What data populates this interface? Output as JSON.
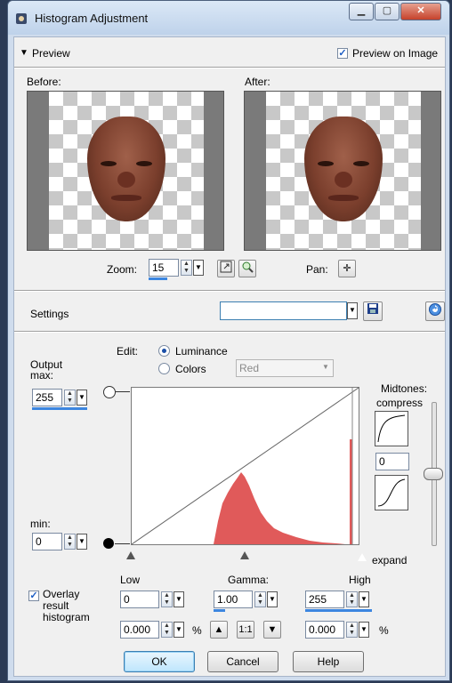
{
  "window": {
    "title": "Histogram Adjustment"
  },
  "preview": {
    "toggle_label": "Preview",
    "preview_on_image_label": "Preview on Image",
    "preview_on_image_checked": true,
    "before_label": "Before:",
    "after_label": "After:",
    "zoom_label": "Zoom:",
    "zoom_value": "15",
    "pan_label": "Pan:"
  },
  "settings": {
    "label": "Settings",
    "value": ""
  },
  "edit": {
    "label": "Edit:",
    "luminance_label": "Luminance",
    "colors_label": "Colors",
    "color_channel": "Red",
    "selected": "Luminance"
  },
  "output": {
    "max_label": "Output max:",
    "max_value": "255",
    "min_label": "min:",
    "min_value": "0"
  },
  "midtones": {
    "label": "Midtones:",
    "compress_label": "compress",
    "value": "0",
    "expand_label": "expand"
  },
  "levels": {
    "low_label": "Low",
    "gamma_label": "Gamma:",
    "high_label": "High",
    "low_value": "0",
    "gamma_value": "1.00",
    "high_value": "255",
    "low_percent": "0.000",
    "high_percent": "0.000",
    "percent_sign": "%",
    "one_to_one_label": "1:1"
  },
  "overlay": {
    "label": "Overlay result histogram",
    "checked": true
  },
  "buttons": {
    "ok": "OK",
    "cancel": "Cancel",
    "help": "Help"
  },
  "colors": {
    "histogram_fill": "#e05a5a",
    "accent_blue": "#3c86e0"
  }
}
